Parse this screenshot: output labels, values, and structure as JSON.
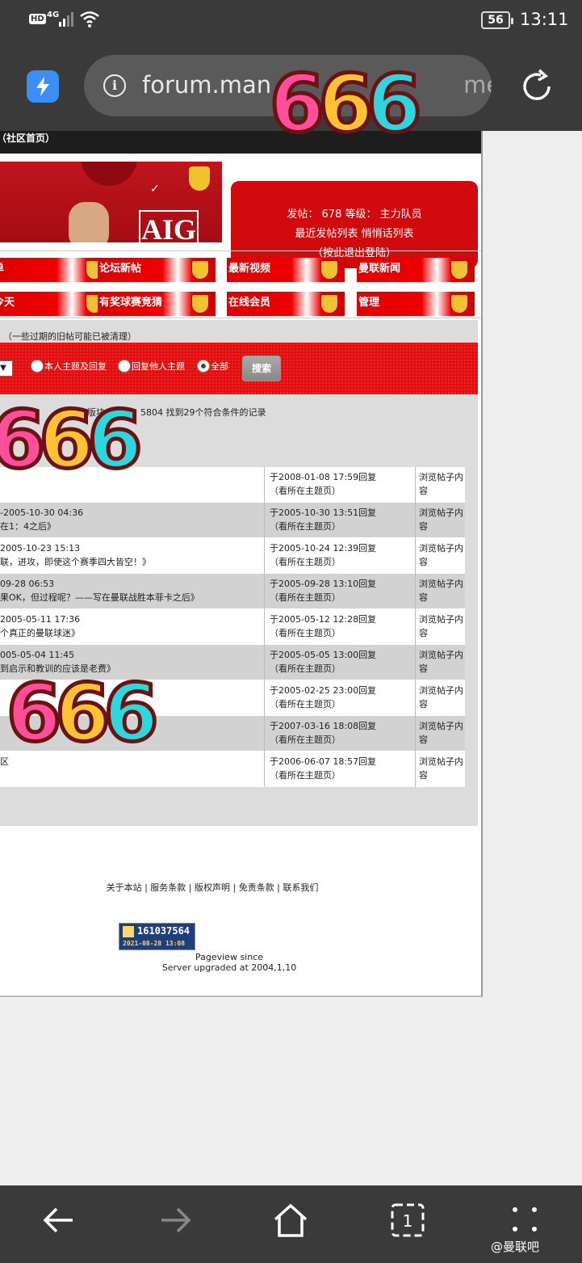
{
  "status_bar": {
    "hd": "HD",
    "network": "4G",
    "battery": "56",
    "time": "13:11"
  },
  "browser": {
    "url_visible": "forum.man",
    "url_tail": "me/"
  },
  "page": {
    "topbar_text": "（社区首页）",
    "user_panel": {
      "line1": "发帖：  678   等级：  主力队员",
      "line2": "最近发帖列表      悄悄话列表",
      "line3": "（按此退出登陆）"
    },
    "nav": [
      {
        "label": "单"
      },
      {
        "label": "论坛新帖"
      },
      {
        "label": "最新视频"
      },
      {
        "label": "曼联新闻"
      },
      {
        "label": "今天"
      },
      {
        "label": "有奖球赛竞猜"
      },
      {
        "label": "在线会员"
      },
      {
        "label": "管理"
      }
    ],
    "note": "（一些过期的旧帖可能已被清理）",
    "radios": [
      {
        "label": "本人主题及回复",
        "checked": false
      },
      {
        "label": "回复他人主题",
        "checked": false
      },
      {
        "label": "全部",
        "checked": true
      }
    ],
    "search_button": "搜索",
    "result_prefix": "版块",
    "result_suffix": "5804 找到29个符合条件的记录",
    "rows": [
      {
        "c1a": "",
        "c1b": "",
        "c2a": "于2008-01-08 17:59回复",
        "c2b": "（看所在主题页）",
        "c3a": "浏览帖子内",
        "c3b": "容"
      },
      {
        "c1a": "-2005-10-30 04:36",
        "c1b": "在1：4之后》",
        "c2a": "于2005-10-30 13:51回复",
        "c2b": "（看所在主题页）",
        "c3a": "浏览帖子内",
        "c3b": "容"
      },
      {
        "c1a": "2005-10-23 15:13",
        "c1b": "联，进攻，即使这个赛季四大皆空！》",
        "c2a": "于2005-10-24 12:39回复",
        "c2b": "（看所在主题页）",
        "c3a": "浏览帖子内",
        "c3b": "容"
      },
      {
        "c1a": "09-28 06:53",
        "c1b": "果OK，但过程呢？——写在曼联战胜本菲卡之后》",
        "c2a": "于2005-09-28 13:10回复",
        "c2b": "（看所在主题页）",
        "c3a": "浏览帖子内",
        "c3b": "容"
      },
      {
        "c1a": "2005-05-11 17:36",
        "c1b": "个真正的曼联球迷》",
        "c2a": "于2005-05-12 12:28回复",
        "c2b": "（看所在主题页）",
        "c3a": "浏览帖子内",
        "c3b": "容"
      },
      {
        "c1a": "005-05-04 11:45",
        "c1b": "到启示和教训的应该是老费》",
        "c2a": "于2005-05-05 13:00回复",
        "c2b": "（看所在主题页）",
        "c3a": "浏览帖子内",
        "c3b": "容"
      },
      {
        "c1a": "",
        "c1b": "",
        "c2a": "于2005-02-25 23:00回复",
        "c2b": "（看所在主题页）",
        "c3a": "浏览帖子内",
        "c3b": "容"
      },
      {
        "c1a": "",
        "c1b": "",
        "c2a": "于2007-03-16 18:08回复",
        "c2b": "（看所在主题页）",
        "c3a": "浏览帖子内",
        "c3b": "容"
      },
      {
        "c1a": "",
        "c1b": "区",
        "c2a": "于2006-06-07 18:57回复",
        "c2b": "（看所在主题页）",
        "c3a": "浏览帖子内",
        "c3b": "容"
      }
    ],
    "footer_links": "关于本站 | 服务条款 | 版权声明 | 免责条款 | 联系我们",
    "counter": {
      "number": "161037564",
      "date": "2021-08-28 13:08"
    },
    "pageview_line1": "Pageview since",
    "pageview_line2": "Server upgraded at 2004,1,10"
  },
  "stickers": {
    "text": "666"
  },
  "watermark": "@曼联吧",
  "colors": {
    "page_red": "#e01010",
    "dark_chrome": "#3a3a3a",
    "sticker_pink": "#ff4f9a",
    "sticker_yellow": "#ffc233",
    "sticker_cyan": "#2fd6de"
  }
}
